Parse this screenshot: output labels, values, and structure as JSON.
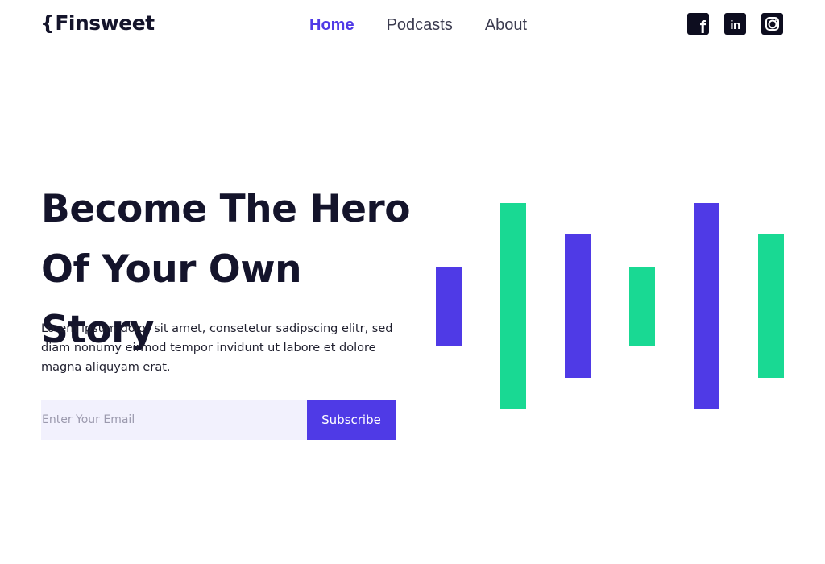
{
  "brand": {
    "brace": "{",
    "name": "Finsweet"
  },
  "nav": {
    "items": [
      {
        "label": "Home",
        "active": true
      },
      {
        "label": "Podcasts",
        "active": false
      },
      {
        "label": "About",
        "active": false
      }
    ]
  },
  "social": {
    "icons": [
      "facebook-icon",
      "linkedin-icon",
      "instagram-icon"
    ],
    "facebook_glyph": "f",
    "linkedin_glyph": "in"
  },
  "hero": {
    "title_line1": "Become The Hero",
    "title_line2": "Of Your Own Story",
    "description": "Lorem ipsum dolor sit amet, consetetur sadipscing elitr, sed diam nonumy eirmod tempor invidunt ut labore et dolore magna aliquyam erat."
  },
  "form": {
    "email_placeholder": "Enter Your Email",
    "email_value": "",
    "subscribe_label": "Subscribe"
  },
  "colors": {
    "accent": "#4f3ae6",
    "green": "#19d993",
    "text": "#14142b",
    "input_bg": "#f2f1fd"
  }
}
